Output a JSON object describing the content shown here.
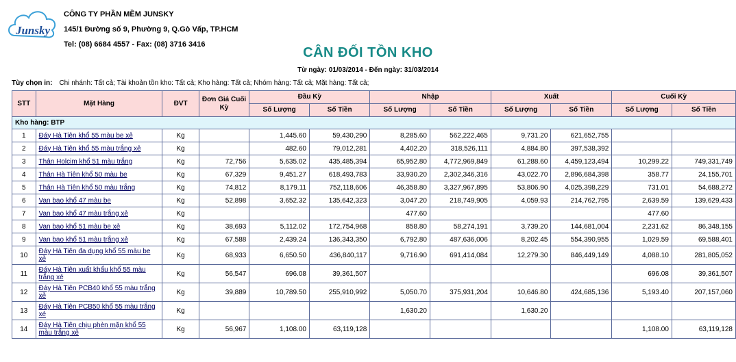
{
  "company": {
    "logo_text": "Junsky",
    "name": "CÔNG TY PHẦN MỀM JUNSKY",
    "address": "145/1 Đường số 9, Phường 9, Q.Gò Vấp, TP.HCM",
    "phone": "Tel: (08) 6684 4557 - Fax: (08) 3716 3416"
  },
  "report": {
    "title": "CÂN ĐỐI TỒN KHO",
    "date_range": "Từ ngày: 01/03/2014 - Đến ngày: 31/03/2014",
    "options_label": "Tùy chọn in:",
    "options_value": "Chi nhánh: Tất cả; Tài khoản tồn kho: Tất cả; Kho hàng: Tất cả; Nhóm hàng: Tất cả; Mặt hàng: Tất cả;"
  },
  "table": {
    "headers": {
      "stt": "STT",
      "item": "Mặt Hàng",
      "unit": "ĐVT",
      "unit_price": "Đơn Giá Cuối Kỳ",
      "opening": "Đầu Kỳ",
      "import": "Nhập",
      "export": "Xuất",
      "closing": "Cuối Kỳ",
      "qty": "Số Lượng",
      "amount": "Số Tiền"
    },
    "group_label": "Kho hàng: BTP",
    "rows": [
      {
        "stt": "1",
        "name": "Đáy Hà Tiên khổ 55 màu be xẻ",
        "unit": "Kg",
        "price": "",
        "open_qty": "1,445.60",
        "open_amt": "59,430,290",
        "in_qty": "8,285.60",
        "in_amt": "562,222,465",
        "out_qty": "9,731.20",
        "out_amt": "621,652,755",
        "close_qty": "",
        "close_amt": ""
      },
      {
        "stt": "2",
        "name": "Đáy Hà Tiên khổ 55 màu trắng xẻ",
        "unit": "Kg",
        "price": "",
        "open_qty": "482.60",
        "open_amt": "79,012,281",
        "in_qty": "4,402.20",
        "in_amt": "318,526,111",
        "out_qty": "4,884.80",
        "out_amt": "397,538,392",
        "close_qty": "",
        "close_amt": ""
      },
      {
        "stt": "3",
        "name": "Thân Holcim khổ 51 màu trắng",
        "unit": "Kg",
        "price": "72,756",
        "open_qty": "5,635.02",
        "open_amt": "435,485,394",
        "in_qty": "65,952.80",
        "in_amt": "4,772,969,849",
        "out_qty": "61,288.60",
        "out_amt": "4,459,123,494",
        "close_qty": "10,299.22",
        "close_amt": "749,331,749"
      },
      {
        "stt": "4",
        "name": "Thân Hà Tiên khổ 50 màu be",
        "unit": "Kg",
        "price": "67,329",
        "open_qty": "9,451.27",
        "open_amt": "618,493,783",
        "in_qty": "33,930.20",
        "in_amt": "2,302,346,316",
        "out_qty": "43,022.70",
        "out_amt": "2,896,684,398",
        "close_qty": "358.77",
        "close_amt": "24,155,701"
      },
      {
        "stt": "5",
        "name": "Thân Hà Tiên khổ 50 màu trắng",
        "unit": "Kg",
        "price": "74,812",
        "open_qty": "8,179.11",
        "open_amt": "752,118,606",
        "in_qty": "46,358.80",
        "in_amt": "3,327,967,895",
        "out_qty": "53,806.90",
        "out_amt": "4,025,398,229",
        "close_qty": "731.01",
        "close_amt": "54,688,272"
      },
      {
        "stt": "6",
        "name": "Van bao khổ 47 màu be",
        "unit": "Kg",
        "price": "52,898",
        "open_qty": "3,652.32",
        "open_amt": "135,642,323",
        "in_qty": "3,047.20",
        "in_amt": "218,749,905",
        "out_qty": "4,059.93",
        "out_amt": "214,762,795",
        "close_qty": "2,639.59",
        "close_amt": "139,629,433"
      },
      {
        "stt": "7",
        "name": "Van bao khổ 47 màu trắng xẻ",
        "unit": "Kg",
        "price": "",
        "open_qty": "",
        "open_amt": "",
        "in_qty": "477.60",
        "in_amt": "",
        "out_qty": "",
        "out_amt": "",
        "close_qty": "477.60",
        "close_amt": ""
      },
      {
        "stt": "8",
        "name": "Van bao khổ 51 màu be xẻ",
        "unit": "Kg",
        "price": "38,693",
        "open_qty": "5,112.02",
        "open_amt": "172,754,968",
        "in_qty": "858.80",
        "in_amt": "58,274,191",
        "out_qty": "3,739.20",
        "out_amt": "144,681,004",
        "close_qty": "2,231.62",
        "close_amt": "86,348,155"
      },
      {
        "stt": "9",
        "name": "Van bao khổ 51 màu trắng xẻ",
        "unit": "Kg",
        "price": "67,588",
        "open_qty": "2,439.24",
        "open_amt": "136,343,350",
        "in_qty": "6,792.80",
        "in_amt": "487,636,006",
        "out_qty": "8,202.45",
        "out_amt": "554,390,955",
        "close_qty": "1,029.59",
        "close_amt": "69,588,401"
      },
      {
        "stt": "10",
        "name": "Đáy Hà Tiên đa dụng khổ 55 màu be xẻ",
        "unit": "Kg",
        "price": "68,933",
        "open_qty": "6,650.50",
        "open_amt": "436,840,117",
        "in_qty": "9,716.90",
        "in_amt": "691,414,084",
        "out_qty": "12,279.30",
        "out_amt": "846,449,149",
        "close_qty": "4,088.10",
        "close_amt": "281,805,052"
      },
      {
        "stt": "11",
        "name": "Đáy Hà Tiên xuất khẩu khổ 55 màu trắng xẻ",
        "unit": "Kg",
        "price": "56,547",
        "open_qty": "696.08",
        "open_amt": "39,361,507",
        "in_qty": "",
        "in_amt": "",
        "out_qty": "",
        "out_amt": "",
        "close_qty": "696.08",
        "close_amt": "39,361,507"
      },
      {
        "stt": "12",
        "name": "Đáy Hà Tiên PCB40 khổ 55 màu trắng xẻ",
        "unit": "Kg",
        "price": "39,889",
        "open_qty": "10,789.50",
        "open_amt": "255,910,992",
        "in_qty": "5,050.70",
        "in_amt": "375,931,204",
        "out_qty": "10,646.80",
        "out_amt": "424,685,136",
        "close_qty": "5,193.40",
        "close_amt": "207,157,060"
      },
      {
        "stt": "13",
        "name": "Đáy Hà Tiên PCB50 khổ 55 màu trắng xẻ",
        "unit": "Kg",
        "price": "",
        "open_qty": "",
        "open_amt": "",
        "in_qty": "1,630.20",
        "in_amt": "",
        "out_qty": "1,630.20",
        "out_amt": "",
        "close_qty": "",
        "close_amt": ""
      },
      {
        "stt": "14",
        "name": "Đáy Hà Tiên chịu phèn mặn khổ 55 màu trắng xẻ",
        "unit": "Kg",
        "price": "56,967",
        "open_qty": "1,108.00",
        "open_amt": "63,119,128",
        "in_qty": "",
        "in_amt": "",
        "out_qty": "",
        "out_amt": "",
        "close_qty": "1,108.00",
        "close_amt": "63,119,128"
      }
    ]
  }
}
